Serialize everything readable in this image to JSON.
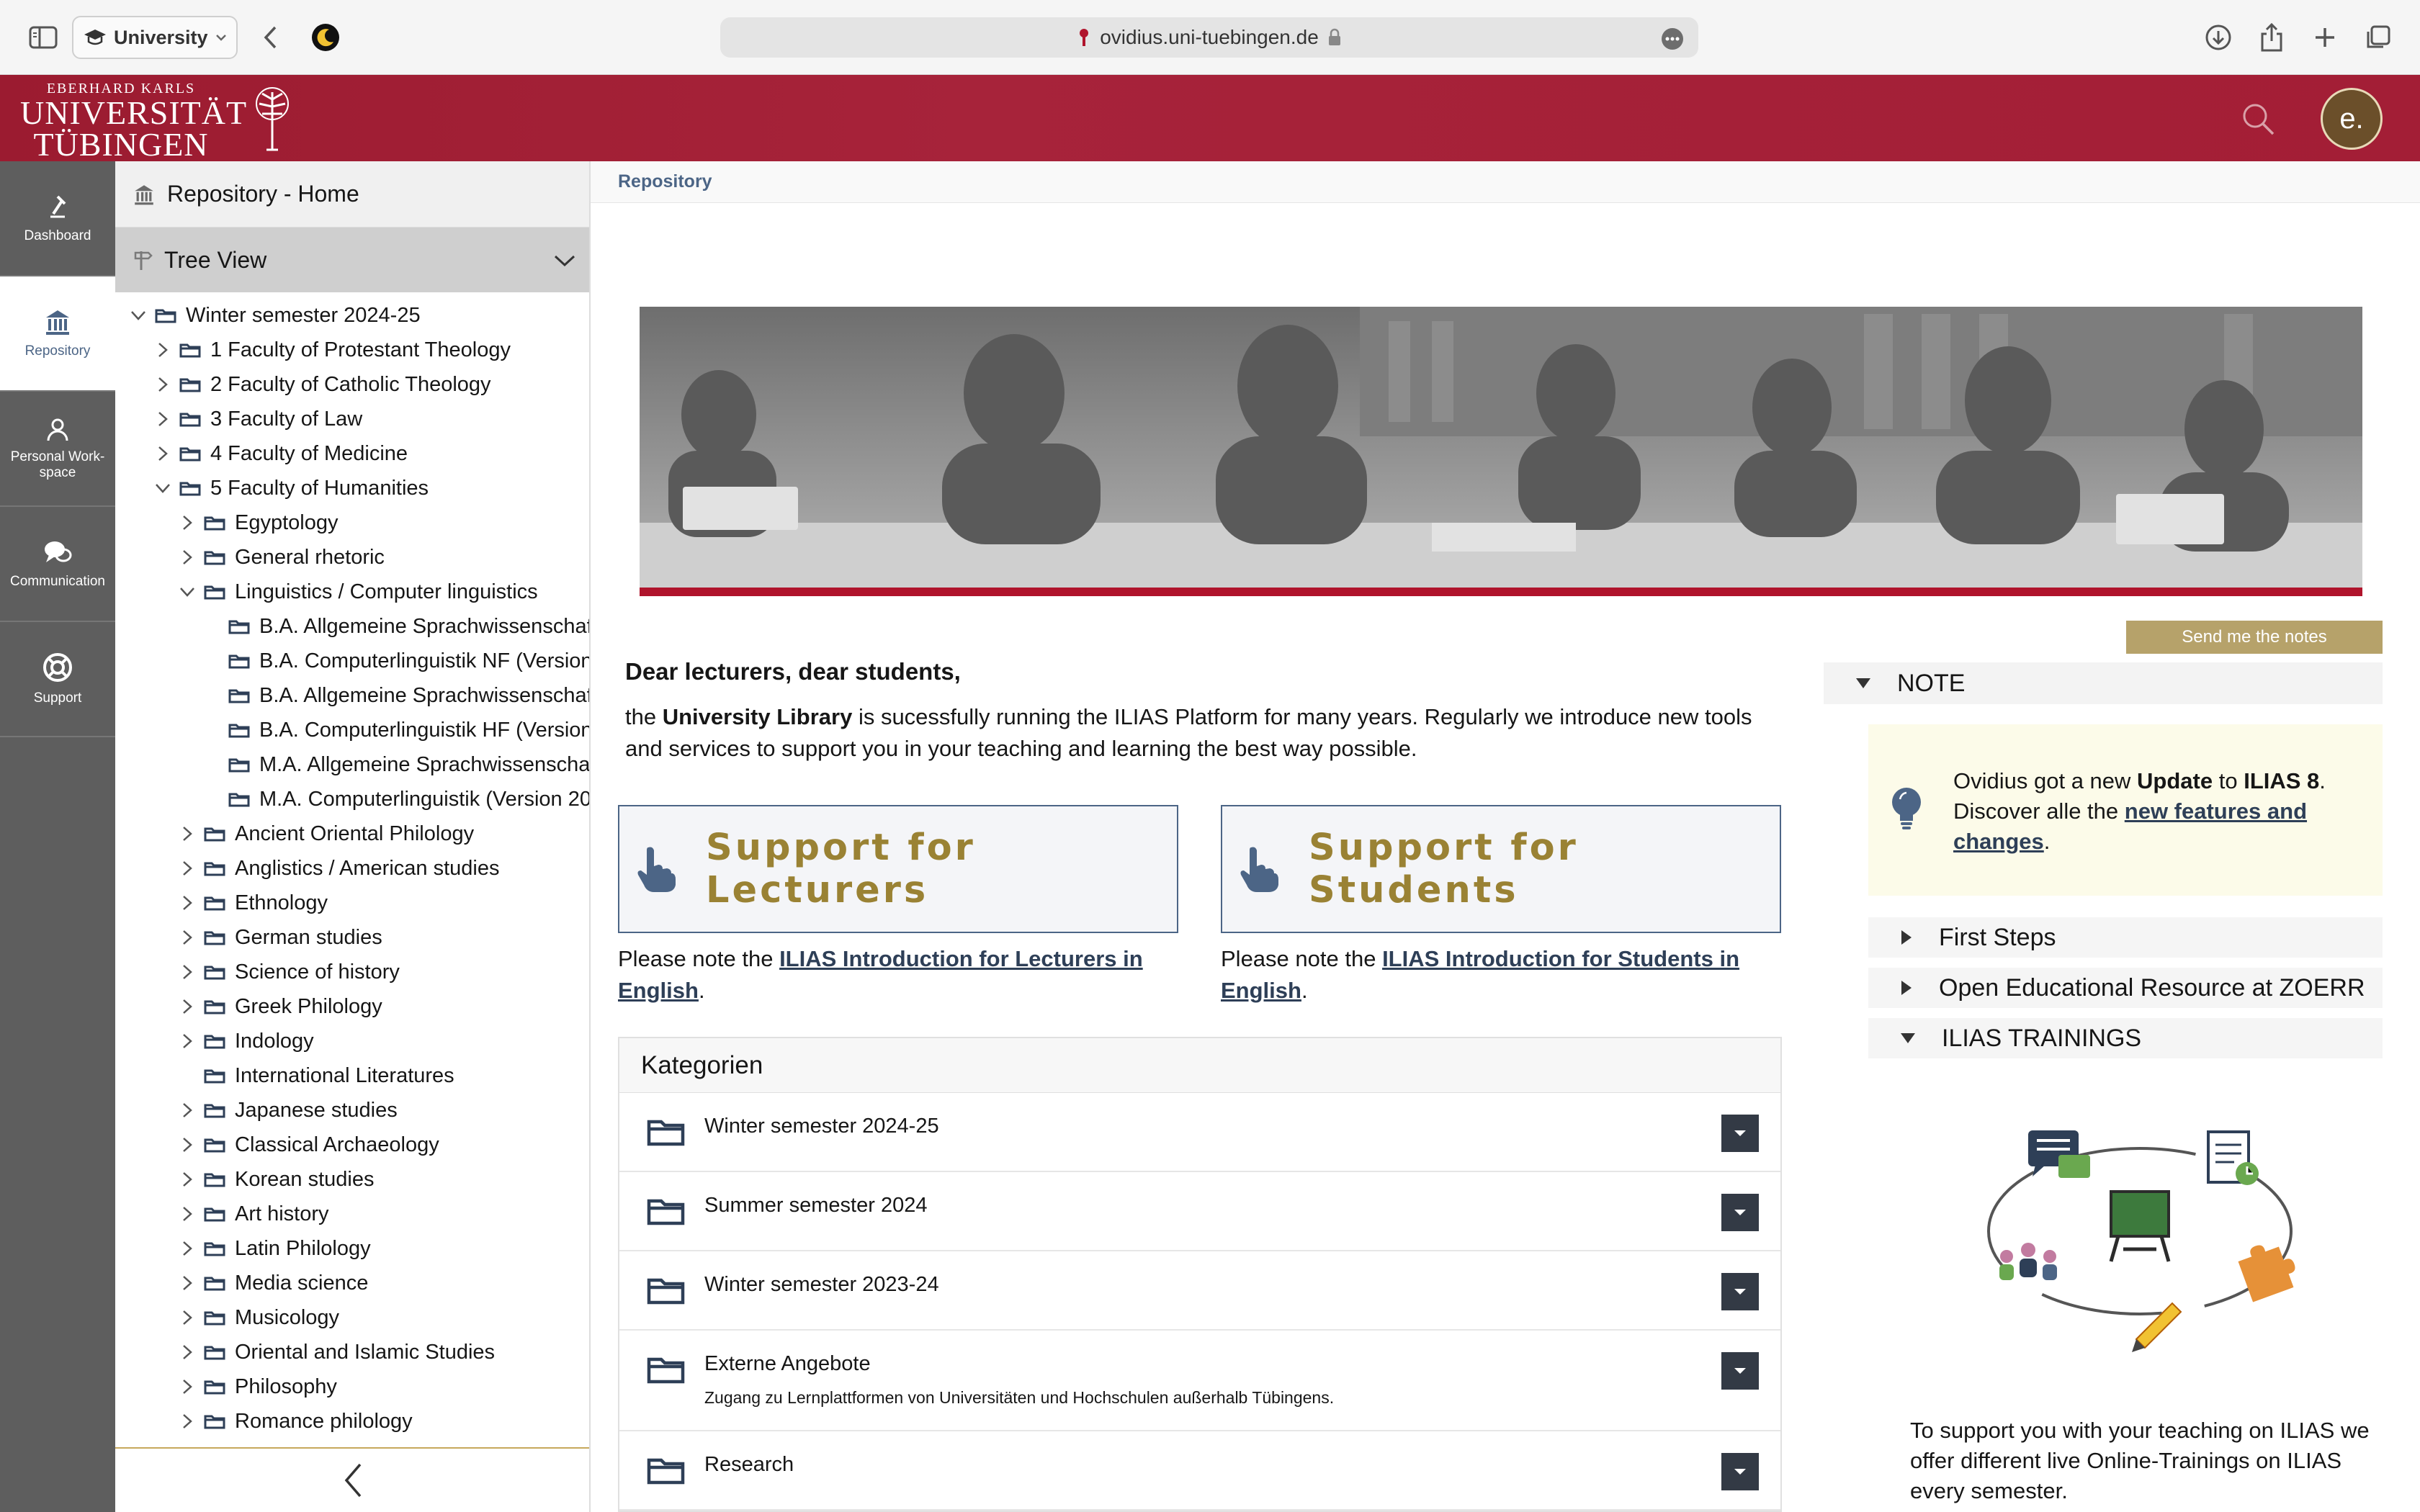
{
  "browser": {
    "tab_group_label": "University",
    "url": "ovidius.uni-tuebingen.de"
  },
  "header": {
    "logo_line1": "EBERHARD KARLS",
    "logo_line2": "UNIVERSITÄT",
    "logo_line3": "TÜBINGEN",
    "avatar_letter": "e."
  },
  "mainbar": {
    "items": [
      {
        "label": "Dashboard"
      },
      {
        "label": "Repository"
      },
      {
        "label": "Personal Work-space"
      },
      {
        "label": "Communication"
      },
      {
        "label": "Support"
      }
    ]
  },
  "slate": {
    "repo_home": "Repository - Home",
    "tree_view": "Tree View",
    "tree": [
      {
        "label": "Winter semester 2024-25",
        "level": 0,
        "state": "open"
      },
      {
        "label": "1 Faculty of Protestant Theology",
        "level": 1,
        "state": "closed"
      },
      {
        "label": "2 Faculty of Catholic Theology",
        "level": 1,
        "state": "closed"
      },
      {
        "label": "3 Faculty of Law",
        "level": 1,
        "state": "closed"
      },
      {
        "label": "4 Faculty of Medicine",
        "level": 1,
        "state": "closed"
      },
      {
        "label": "5 Faculty of Humanities",
        "level": 1,
        "state": "open"
      },
      {
        "label": "Egyptology",
        "level": 2,
        "state": "closed"
      },
      {
        "label": "General rhetoric",
        "level": 2,
        "state": "closed"
      },
      {
        "label": "Linguistics / Computer linguistics",
        "level": 2,
        "state": "open"
      },
      {
        "label": "B.A. Allgemeine Sprachwissenschaft",
        "level": 3,
        "state": "none"
      },
      {
        "label": "B.A. Computerlinguistik NF (Version",
        "level": 3,
        "state": "none"
      },
      {
        "label": "B.A. Allgemeine Sprachwissenschaft",
        "level": 3,
        "state": "none"
      },
      {
        "label": "B.A. Computerlinguistik HF (Version",
        "level": 3,
        "state": "none"
      },
      {
        "label": "M.A. Allgemeine Sprachwissenschaft",
        "level": 3,
        "state": "none"
      },
      {
        "label": "M.A. Computerlinguistik (Version 20",
        "level": 3,
        "state": "none"
      },
      {
        "label": "Ancient Oriental Philology",
        "level": 2,
        "state": "closed"
      },
      {
        "label": "Anglistics / American studies",
        "level": 2,
        "state": "closed"
      },
      {
        "label": "Ethnology",
        "level": 2,
        "state": "closed"
      },
      {
        "label": "German studies",
        "level": 2,
        "state": "closed"
      },
      {
        "label": "Science of history",
        "level": 2,
        "state": "closed"
      },
      {
        "label": "Greek Philology",
        "level": 2,
        "state": "closed"
      },
      {
        "label": "Indology",
        "level": 2,
        "state": "closed"
      },
      {
        "label": "International Literatures",
        "level": 2,
        "state": "none"
      },
      {
        "label": "Japanese studies",
        "level": 2,
        "state": "closed"
      },
      {
        "label": "Classical Archaeology",
        "level": 2,
        "state": "closed"
      },
      {
        "label": "Korean studies",
        "level": 2,
        "state": "closed"
      },
      {
        "label": "Art history",
        "level": 2,
        "state": "closed"
      },
      {
        "label": "Latin Philology",
        "level": 2,
        "state": "closed"
      },
      {
        "label": "Media science",
        "level": 2,
        "state": "closed"
      },
      {
        "label": "Musicology",
        "level": 2,
        "state": "closed"
      },
      {
        "label": "Oriental and Islamic Studies",
        "level": 2,
        "state": "closed"
      },
      {
        "label": "Philosophy",
        "level": 2,
        "state": "closed"
      },
      {
        "label": "Romance philology",
        "level": 2,
        "state": "closed"
      }
    ]
  },
  "breadcrumb": "Repository",
  "notes_button": "Send me the notes",
  "welcome": {
    "title": "Dear lecturers, dear students,",
    "pre": "the ",
    "bold": "University Library",
    "post": " is sucessfully running the ILIAS Platform for many years. Regularly we introduce new tools and services to support you in your teaching and learning the best way possible."
  },
  "support": [
    {
      "title": "Support for Lecturers",
      "pre": "Please note the ",
      "link": "ILIAS Introduction for Lecturers in English",
      "post": "."
    },
    {
      "title": "Support for Students",
      "pre": "Please note the ",
      "link": "ILIAS Introduction for Students in English",
      "post": "."
    }
  ],
  "categories": {
    "title": "Kategorien",
    "items": [
      {
        "title": "Winter semester 2024-25",
        "desc": ""
      },
      {
        "title": "Summer semester 2024",
        "desc": ""
      },
      {
        "title": "Winter semester 2023-24",
        "desc": ""
      },
      {
        "title": "Externe Angebote",
        "desc": "Zugang zu Lernplattformen von Universitäten und Hochschulen außerhalb Tübingens."
      },
      {
        "title": "Research",
        "desc": ""
      }
    ]
  },
  "note": {
    "heading": "NOTE",
    "t1": "Ovidius got a new ",
    "b1": "Update",
    "t2": " to ",
    "b2": "ILIAS 8",
    "t3": ". Discover alle the ",
    "link": "new features and changes",
    "t4": "."
  },
  "accordion": [
    {
      "label": "First Steps",
      "state": "closed"
    },
    {
      "label": "Open Educational Resource at ZOERR",
      "state": "closed"
    },
    {
      "label": "ILIAS TRAININGS",
      "state": "open"
    }
  ],
  "trainings_text": "To support you with your teaching on ILIAS we offer different live Online-Trainings on ILIAS every semester.",
  "colors": {
    "brand_red": "#a51e36",
    "mainbar": "#5e5e5e",
    "accent_gold": "#9a8234",
    "link_blue": "#2e3f57"
  }
}
